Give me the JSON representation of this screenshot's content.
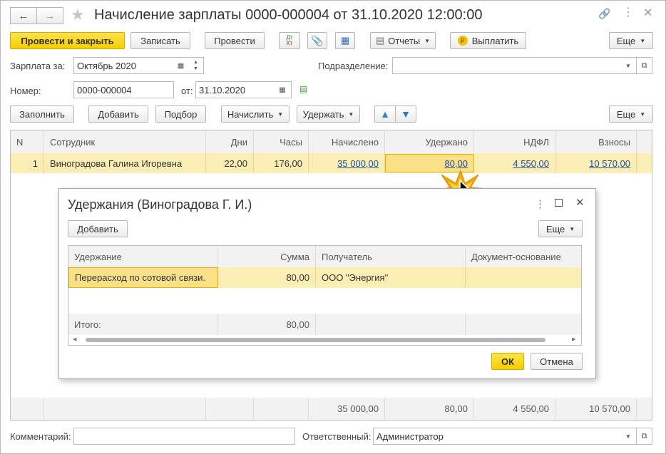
{
  "window": {
    "title": "Начисление зарплаты 0000-000004 от 31.10.2020 12:00:00"
  },
  "toolbar": {
    "post_close": "Провести и закрыть",
    "save": "Записать",
    "post": "Провести",
    "dtkt_top": "Дт",
    "dtkt_bottom": "Кт",
    "reports": "Отчеты",
    "pay": "Выплатить",
    "more": "Еще"
  },
  "form": {
    "salary_for_label": "Зарплата за:",
    "salary_for_value": "Октябрь 2020",
    "department_label": "Подразделение:",
    "department_value": "",
    "number_label": "Номер:",
    "number_value": "0000-000004",
    "date_label": "от:",
    "date_value": "31.10.2020"
  },
  "table_toolbar": {
    "fill": "Заполнить",
    "add": "Добавить",
    "select": "Подбор",
    "accrue": "Начислить",
    "withhold": "Удержать",
    "more": "Еще"
  },
  "grid": {
    "columns": [
      "N",
      "Сотрудник",
      "Дни",
      "Часы",
      "Начислено",
      "Удержано",
      "НДФЛ",
      "Взносы"
    ],
    "rows": [
      {
        "n": "1",
        "employee": "Виноградова Галина Игоревна",
        "days": "22,00",
        "hours": "176,00",
        "accrued": "35 000,00",
        "withheld": "80,00",
        "ndfl": "4 550,00",
        "contributions": "10 570,00"
      }
    ],
    "totals": {
      "accrued": "35 000,00",
      "withheld": "80,00",
      "ndfl": "4 550,00",
      "contributions": "10 570,00"
    }
  },
  "dialog": {
    "title": "Удержания (Виноградова Г. И.)",
    "add": "Добавить",
    "more": "Еще",
    "columns": [
      "Удержание",
      "Сумма",
      "Получатель",
      "Документ-основание"
    ],
    "rows": [
      {
        "deduction": "Перерасход по сотовой связи.",
        "amount": "80,00",
        "recipient": "ООО \"Энергия\"",
        "basis": ""
      }
    ],
    "total_label": "Итого:",
    "total_amount": "80,00",
    "ok": "ОК",
    "cancel": "Отмена"
  },
  "footer": {
    "comment_label": "Комментарий:",
    "comment_value": "",
    "responsible_label": "Ответственный:",
    "responsible_value": "Администратор"
  },
  "colors": {
    "accent_yellow": "#f5cf00",
    "selected_row": "#fbeeb4",
    "link_blue": "#1a4fa3"
  }
}
